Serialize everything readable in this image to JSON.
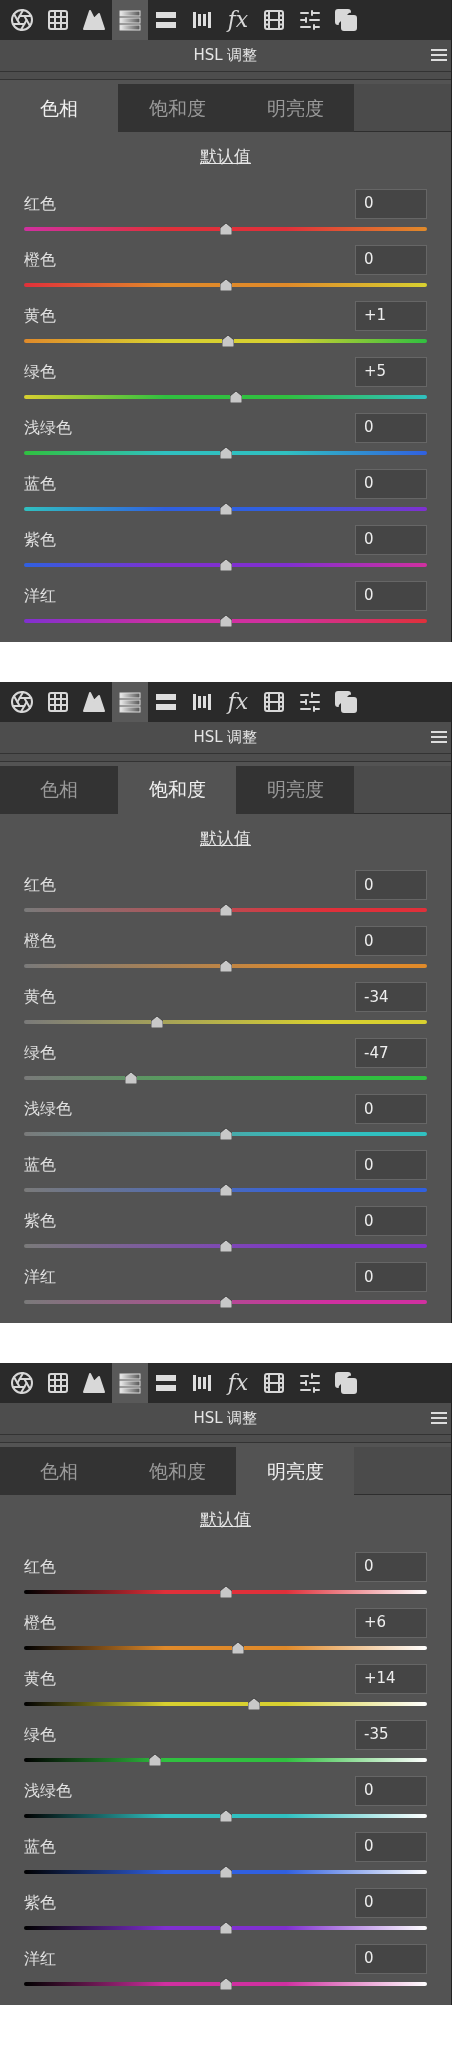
{
  "panels": [
    {
      "kind": "hue",
      "toolbar": [
        {
          "kind": "aperture",
          "selected": false
        },
        {
          "kind": "grid",
          "selected": false
        },
        {
          "kind": "mountain",
          "selected": false
        },
        {
          "kind": "gradient",
          "selected": true
        },
        {
          "kind": "bars",
          "selected": false
        },
        {
          "kind": "lens",
          "selected": false
        },
        {
          "kind": "fx",
          "label": "fx",
          "selected": false
        },
        {
          "kind": "film",
          "selected": false
        },
        {
          "kind": "sliders",
          "selected": false
        },
        {
          "kind": "stack",
          "selected": false
        }
      ],
      "title": "HSL 调整",
      "tabs": [
        {
          "label": "色相",
          "selected": true
        },
        {
          "label": "饱和度",
          "selected": false
        },
        {
          "label": "明亮度",
          "selected": false
        }
      ],
      "default_link": "默认值",
      "rows": [
        {
          "label": "红色",
          "value": "0",
          "level": 0.5,
          "color": "#e0303a"
        },
        {
          "label": "橙色",
          "value": "0",
          "level": 0.5,
          "color": "#e08a2a"
        },
        {
          "label": "黄色",
          "value": "+1",
          "level": 0.505,
          "color": "#d8d030"
        },
        {
          "label": "绿色",
          "value": "+5",
          "level": 0.525,
          "color": "#30c040"
        },
        {
          "label": "浅绿色",
          "value": "0",
          "level": 0.5,
          "color": "#30c0c0"
        },
        {
          "label": "蓝色",
          "value": "0",
          "level": 0.5,
          "color": "#3060e0"
        },
        {
          "label": "紫色",
          "value": "0",
          "level": 0.5,
          "color": "#8030d0"
        },
        {
          "label": "洋红",
          "value": "0",
          "level": 0.5,
          "color": "#d030a0"
        }
      ]
    },
    {
      "kind": "saturation",
      "toolbar": [
        {
          "kind": "aperture",
          "selected": false
        },
        {
          "kind": "grid",
          "selected": false
        },
        {
          "kind": "mountain",
          "selected": false
        },
        {
          "kind": "gradient",
          "selected": true
        },
        {
          "kind": "bars",
          "selected": false
        },
        {
          "kind": "lens",
          "selected": false
        },
        {
          "kind": "fx",
          "label": "fx",
          "selected": false
        },
        {
          "kind": "film",
          "selected": false
        },
        {
          "kind": "sliders",
          "selected": false
        },
        {
          "kind": "stack",
          "selected": false
        }
      ],
      "title": "HSL 调整",
      "tabs": [
        {
          "label": "色相",
          "selected": false
        },
        {
          "label": "饱和度",
          "selected": true
        },
        {
          "label": "明亮度",
          "selected": false
        }
      ],
      "default_link": "默认值",
      "rows": [
        {
          "label": "红色",
          "value": "0",
          "level": 0.5,
          "color": "#e0303a"
        },
        {
          "label": "橙色",
          "value": "0",
          "level": 0.5,
          "color": "#e08a2a"
        },
        {
          "label": "黄色",
          "value": "-34",
          "level": 0.33,
          "color": "#d8d030"
        },
        {
          "label": "绿色",
          "value": "-47",
          "level": 0.265,
          "color": "#30c040"
        },
        {
          "label": "浅绿色",
          "value": "0",
          "level": 0.5,
          "color": "#30c0c0"
        },
        {
          "label": "蓝色",
          "value": "0",
          "level": 0.5,
          "color": "#3060e0"
        },
        {
          "label": "紫色",
          "value": "0",
          "level": 0.5,
          "color": "#8030d0"
        },
        {
          "label": "洋红",
          "value": "0",
          "level": 0.5,
          "color": "#d030a0"
        }
      ]
    },
    {
      "kind": "luminance",
      "toolbar": [
        {
          "kind": "aperture",
          "selected": false
        },
        {
          "kind": "grid",
          "selected": false
        },
        {
          "kind": "mountain",
          "selected": false
        },
        {
          "kind": "gradient",
          "selected": true
        },
        {
          "kind": "bars",
          "selected": false
        },
        {
          "kind": "lens",
          "selected": false
        },
        {
          "kind": "fx",
          "label": "fx",
          "selected": false
        },
        {
          "kind": "film",
          "selected": false
        },
        {
          "kind": "sliders",
          "selected": false
        },
        {
          "kind": "stack",
          "selected": false
        }
      ],
      "title": "HSL 调整",
      "tabs": [
        {
          "label": "色相",
          "selected": false
        },
        {
          "label": "饱和度",
          "selected": false
        },
        {
          "label": "明亮度",
          "selected": true
        }
      ],
      "default_link": "默认值",
      "rows": [
        {
          "label": "红色",
          "value": "0",
          "level": 0.5,
          "color": "#e0303a"
        },
        {
          "label": "橙色",
          "value": "+6",
          "level": 0.53,
          "color": "#e08a2a"
        },
        {
          "label": "黄色",
          "value": "+14",
          "level": 0.57,
          "color": "#d8d030"
        },
        {
          "label": "绿色",
          "value": "-35",
          "level": 0.325,
          "color": "#30c040"
        },
        {
          "label": "浅绿色",
          "value": "0",
          "level": 0.5,
          "color": "#30c0c0"
        },
        {
          "label": "蓝色",
          "value": "0",
          "level": 0.5,
          "color": "#3060e0"
        },
        {
          "label": "紫色",
          "value": "0",
          "level": 0.5,
          "color": "#8030d0"
        },
        {
          "label": "洋红",
          "value": "0",
          "level": 0.5,
          "color": "#d030a0"
        }
      ]
    }
  ]
}
